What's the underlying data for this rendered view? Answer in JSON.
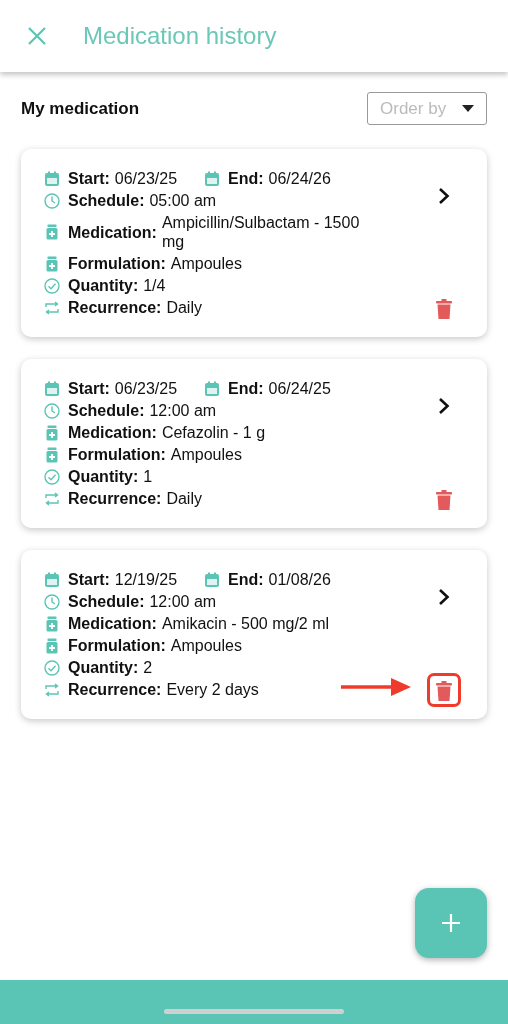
{
  "header": {
    "title": "Medication history"
  },
  "section": {
    "title": "My medication",
    "order_by": {
      "placeholder": "Order by"
    }
  },
  "cards": [
    {
      "highlighted": false,
      "start": {
        "label": "Start:",
        "value": "06/23/25"
      },
      "end": {
        "label": "End:",
        "value": "06/24/26"
      },
      "details": [
        {
          "kind": "schedule",
          "label": "Schedule:",
          "value": "05:00 am"
        },
        {
          "kind": "medication",
          "label": "Medication:",
          "value": "Ampicillin/Sulbactam - 1500 mg"
        },
        {
          "kind": "formulation",
          "label": "Formulation:",
          "value": "Ampoules"
        },
        {
          "kind": "quantity",
          "label": "Quantity:",
          "value": "1/4"
        },
        {
          "kind": "recurrence",
          "label": "Recurrence:",
          "value": "Daily"
        }
      ]
    },
    {
      "highlighted": false,
      "start": {
        "label": "Start:",
        "value": "06/23/25"
      },
      "end": {
        "label": "End:",
        "value": "06/24/25"
      },
      "details": [
        {
          "kind": "schedule",
          "label": "Schedule:",
          "value": "12:00 am"
        },
        {
          "kind": "medication",
          "label": "Medication:",
          "value": "Cefazolin - 1 g"
        },
        {
          "kind": "formulation",
          "label": "Formulation:",
          "value": "Ampoules"
        },
        {
          "kind": "quantity",
          "label": "Quantity:",
          "value": "1"
        },
        {
          "kind": "recurrence",
          "label": "Recurrence:",
          "value": "Daily"
        }
      ]
    },
    {
      "highlighted": true,
      "start": {
        "label": "Start:",
        "value": "12/19/25"
      },
      "end": {
        "label": "End:",
        "value": "01/08/26"
      },
      "details": [
        {
          "kind": "schedule",
          "label": "Schedule:",
          "value": "12:00 am"
        },
        {
          "kind": "medication",
          "label": "Medication:",
          "value": "Amikacin - 500 mg/2 ml"
        },
        {
          "kind": "formulation",
          "label": "Formulation:",
          "value": "Ampoules"
        },
        {
          "kind": "quantity",
          "label": "Quantity:",
          "value": "2"
        },
        {
          "kind": "recurrence",
          "label": "Recurrence:",
          "value": "Every 2 days"
        }
      ]
    }
  ]
}
